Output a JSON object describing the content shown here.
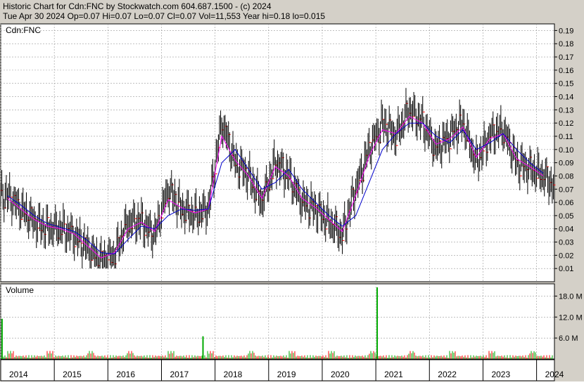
{
  "header": {
    "title": "Historic Chart for Cdn:FNC by Stockwatch.com 604.687.1500 - (c) 2024",
    "stats": "Tue Apr 30 2024  Op=0.07  Hi=0.07  Lo=0.07  Cl=0.07  Vol=11,553  Year hi=0.18  lo=0.015"
  },
  "colors": {
    "background": "#d4d0c8",
    "plot": "#ffffff",
    "grid": "#9a9a9a",
    "price_bars": "#000000",
    "short_ma": "#ff00ff",
    "long_ma": "#0000cc",
    "close_marker": "#ff0000",
    "volume_up": "#00aa00",
    "volume_down": "#ff0000"
  },
  "chart_data": [
    {
      "type": "line",
      "title": "Cdn:FNC",
      "ylim": [
        0,
        0.195
      ],
      "yticks": [
        "0.19",
        "0.18",
        "0.17",
        "0.16",
        "0.15",
        "0.14",
        "0.13",
        "0.12",
        "0.11",
        "0.10",
        "0.09",
        "0.08",
        "0.07",
        "0.06",
        "0.05",
        "0.04",
        "0.03",
        "0.02",
        "0.01"
      ],
      "grid": true,
      "x": [
        "2014-01",
        "2014-04",
        "2014-07",
        "2014-10",
        "2015-01",
        "2015-04",
        "2015-07",
        "2015-10",
        "2016-01",
        "2016-04",
        "2016-07",
        "2016-10",
        "2017-01",
        "2017-04",
        "2017-07",
        "2017-10",
        "2018-01",
        "2018-04",
        "2018-07",
        "2018-10",
        "2019-01",
        "2019-04",
        "2019-07",
        "2019-10",
        "2020-01",
        "2020-04",
        "2020-07",
        "2020-10",
        "2021-01",
        "2021-04",
        "2021-07",
        "2021-10",
        "2022-01",
        "2022-04",
        "2022-07",
        "2022-10",
        "2023-01",
        "2023-04",
        "2023-07",
        "2023-10",
        "2024-01",
        "2024-04"
      ],
      "series": [
        {
          "name": "price",
          "values": [
            0.065,
            0.055,
            0.045,
            0.04,
            0.04,
            0.035,
            0.025,
            0.015,
            0.02,
            0.045,
            0.045,
            0.035,
            0.07,
            0.055,
            0.05,
            0.055,
            0.12,
            0.09,
            0.08,
            0.06,
            0.09,
            0.08,
            0.06,
            0.055,
            0.045,
            0.035,
            0.07,
            0.1,
            0.12,
            0.11,
            0.13,
            0.12,
            0.1,
            0.11,
            0.12,
            0.09,
            0.11,
            0.115,
            0.09,
            0.085,
            0.08,
            0.07
          ]
        },
        {
          "name": "short_ma",
          "values": [
            0.063,
            0.055,
            0.047,
            0.042,
            0.04,
            0.036,
            0.027,
            0.018,
            0.022,
            0.04,
            0.045,
            0.038,
            0.062,
            0.056,
            0.052,
            0.055,
            0.11,
            0.092,
            0.08,
            0.063,
            0.087,
            0.08,
            0.063,
            0.056,
            0.047,
            0.038,
            0.065,
            0.095,
            0.115,
            0.112,
            0.125,
            0.12,
            0.104,
            0.108,
            0.117,
            0.094,
            0.108,
            0.112,
            0.093,
            0.087,
            0.08,
            0.073
          ]
        },
        {
          "name": "long_ma",
          "values": [
            0.065,
            0.058,
            0.05,
            0.044,
            0.041,
            0.038,
            0.031,
            0.022,
            0.021,
            0.032,
            0.042,
            0.04,
            0.05,
            0.055,
            0.054,
            0.055,
            0.09,
            0.1,
            0.085,
            0.07,
            0.075,
            0.085,
            0.07,
            0.06,
            0.05,
            0.042,
            0.05,
            0.075,
            0.1,
            0.112,
            0.12,
            0.12,
            0.11,
            0.105,
            0.115,
            0.1,
            0.105,
            0.112,
            0.1,
            0.09,
            0.082,
            0.078
          ]
        }
      ]
    },
    {
      "type": "bar",
      "title": "Volume",
      "ylim": [
        0,
        21.5
      ],
      "yticks": [
        "18.0 M",
        "12.0 M",
        "6.0 M"
      ],
      "x": [
        "2014-01",
        "2017-10",
        "2021-01"
      ],
      "values": [
        0.4,
        6.5,
        20.5
      ],
      "spikes": [
        {
          "x": "2014-01",
          "value": 11.5
        },
        {
          "x": "2017-10",
          "value": 6.5
        },
        {
          "x": "2021-01",
          "value": 20.5
        }
      ]
    }
  ],
  "x_axis": {
    "years": [
      "2014",
      "2015",
      "2016",
      "2017",
      "2018",
      "2019",
      "2020",
      "2021",
      "2022",
      "2023",
      "2024"
    ]
  }
}
